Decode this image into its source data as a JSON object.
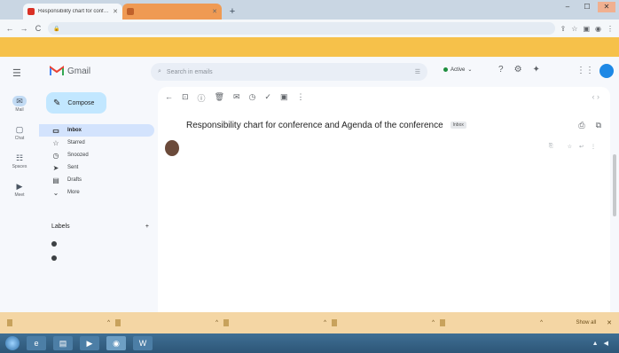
{
  "browser": {
    "tabs": [
      {
        "title": "Responsibility chart for conference",
        "active": true
      },
      {
        "title": "",
        "active": false
      }
    ],
    "new_tab": "+",
    "window_controls": {
      "minimize": "–",
      "maximize": "☐",
      "close": "✕"
    },
    "back": "←",
    "forward": "→",
    "reload": "C",
    "url": "",
    "infobar": {
      "text": "",
      "button": ""
    }
  },
  "gmail": {
    "product_name": "Gmail",
    "search_placeholder": "Search in emails",
    "status": "Active",
    "avatar_initial": "",
    "compose_label": "Compose",
    "rail": [
      {
        "label": "Mail",
        "icon": "✉",
        "badge": ""
      },
      {
        "label": "Chat",
        "icon": "▢"
      },
      {
        "label": "Spaces",
        "icon": "☷"
      },
      {
        "label": "Meet",
        "icon": "▶"
      }
    ],
    "nav": [
      {
        "label": "Inbox",
        "icon": "▭",
        "count": ""
      },
      {
        "label": "Starred",
        "icon": "☆",
        "count": ""
      },
      {
        "label": "Snoozed",
        "icon": "◷",
        "count": ""
      },
      {
        "label": "Sent",
        "icon": "➤",
        "count": ""
      },
      {
        "label": "Drafts",
        "icon": "▤",
        "count": ""
      },
      {
        "label": "More",
        "icon": "⌄",
        "count": ""
      }
    ],
    "labels_header": "Labels",
    "labels_add": "+",
    "labels": [
      {
        "label": ""
      },
      {
        "label": ""
      }
    ],
    "toolbar_icons": [
      "←",
      "⊡",
      "ⓘ",
      "🗑",
      "✉",
      "◷",
      "✓",
      "▣",
      "⋮"
    ],
    "pager": "",
    "email": {
      "subject": "Responsibility chart for conference and Agenda of the conference",
      "subject_tag": "Inbox",
      "sender_name": "",
      "sender_to": "",
      "date": "",
      "body_lines": [],
      "footer_title": "",
      "footer_link": "",
      "footer_lines": []
    }
  },
  "downloads": {
    "items": [
      {
        "name": ""
      },
      {
        "name": ""
      },
      {
        "name": ""
      },
      {
        "name": ""
      },
      {
        "name": ""
      }
    ],
    "show_all": "Show all",
    "close": "✕"
  },
  "taskbar": {
    "apps": [
      "e",
      "▤",
      "▶",
      "◉",
      "W"
    ],
    "clock": ""
  },
  "colors": {
    "compose_bg": "#c2e7ff",
    "inbox_active_bg": "#d3e3fd",
    "infobar_bg": "#f6c14a",
    "downloads_bg": "#f4d6a4",
    "taskbar_bg": "#2d5677"
  }
}
